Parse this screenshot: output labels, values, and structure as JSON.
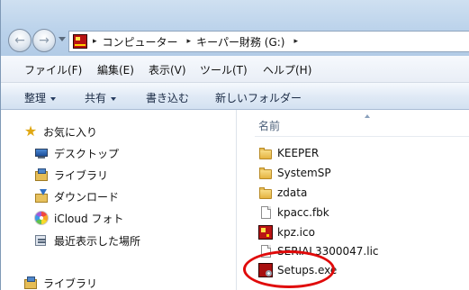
{
  "address_bar": {
    "breadcrumbs": [
      "コンピューター",
      "キーパー財務 (G:)"
    ],
    "separator": "▸"
  },
  "menu": {
    "items": [
      {
        "label": "ファイル(F)"
      },
      {
        "label": "編集(E)"
      },
      {
        "label": "表示(V)"
      },
      {
        "label": "ツール(T)"
      },
      {
        "label": "ヘルプ(H)"
      }
    ]
  },
  "toolbar": {
    "organize_label": "整理",
    "share_label": "共有",
    "burn_label": "書き込む",
    "new_folder_label": "新しいフォルダー"
  },
  "nav_pane": {
    "favorites_label": "お気に入り",
    "items": [
      {
        "label": "デスクトップ",
        "icon": "desktop-icon"
      },
      {
        "label": "ライブラリ",
        "icon": "library-icon"
      },
      {
        "label": "ダウンロード",
        "icon": "download-folder-icon"
      },
      {
        "label": "iCloud フォト",
        "icon": "icloud-photos-icon"
      },
      {
        "label": "最近表示した場所",
        "icon": "recent-places-icon"
      }
    ],
    "libraries_label": "ライブラリ"
  },
  "content": {
    "column_header": "名前",
    "files": [
      {
        "name": "KEEPER",
        "icon": "folder-icon"
      },
      {
        "name": "SystemSP",
        "icon": "folder-icon"
      },
      {
        "name": "zdata",
        "icon": "folder-icon"
      },
      {
        "name": "kpacc.fbk",
        "icon": "file-icon"
      },
      {
        "name": "kpz.ico",
        "icon": "kpz-icon"
      },
      {
        "name": "SERIAL3300047.lic",
        "icon": "file-icon"
      },
      {
        "name": "Setups.exe",
        "icon": "setup-exe-icon"
      }
    ]
  },
  "colors": {
    "highlight_ring": "#e00a0a",
    "toolbar_bg": "#dfe9f5",
    "address_bg": "#b9d1ea"
  }
}
